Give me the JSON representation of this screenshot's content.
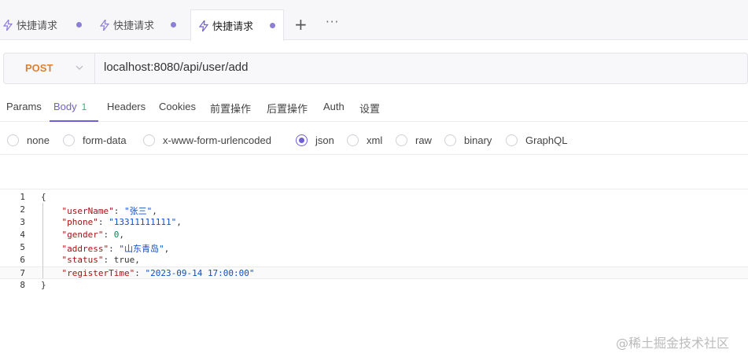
{
  "tabs": [
    {
      "label": "快捷请求"
    },
    {
      "label": "快捷请求"
    },
    {
      "label": "快捷请求"
    }
  ],
  "tab_add": "+",
  "tab_more": "···",
  "request": {
    "method": "POST",
    "url": "localhost:8080/api/user/add"
  },
  "subtabs": [
    {
      "label": "Params"
    },
    {
      "label": "Body",
      "count": "1"
    },
    {
      "label": "Headers"
    },
    {
      "label": "Cookies"
    },
    {
      "label": "前置操作"
    },
    {
      "label": "后置操作"
    },
    {
      "label": "Auth"
    },
    {
      "label": "设置"
    }
  ],
  "body_types": [
    {
      "label": "none"
    },
    {
      "label": "form-data"
    },
    {
      "label": "x-www-form-urlencoded"
    },
    {
      "label": "json",
      "selected": true
    },
    {
      "label": "xml"
    },
    {
      "label": "raw"
    },
    {
      "label": "binary"
    },
    {
      "label": "GraphQL"
    }
  ],
  "editor": {
    "line_numbers": [
      "1",
      "2",
      "3",
      "4",
      "5",
      "6",
      "7",
      "8"
    ],
    "lines": [
      {
        "parts": [
          {
            "t": "p",
            "v": "{"
          }
        ]
      },
      {
        "parts": [
          {
            "t": "p",
            "v": "    "
          },
          {
            "t": "k",
            "v": "\"userName\""
          },
          {
            "t": "p",
            "v": ": "
          },
          {
            "t": "s",
            "v": "\"张三\""
          },
          {
            "t": "p",
            "v": ","
          }
        ]
      },
      {
        "parts": [
          {
            "t": "p",
            "v": "    "
          },
          {
            "t": "k",
            "v": "\"phone\""
          },
          {
            "t": "p",
            "v": ": "
          },
          {
            "t": "s",
            "v": "\"13311111111\""
          },
          {
            "t": "p",
            "v": ","
          }
        ]
      },
      {
        "parts": [
          {
            "t": "p",
            "v": "    "
          },
          {
            "t": "k",
            "v": "\"gender\""
          },
          {
            "t": "p",
            "v": ": "
          },
          {
            "t": "n",
            "v": "0"
          },
          {
            "t": "p",
            "v": ","
          }
        ]
      },
      {
        "parts": [
          {
            "t": "p",
            "v": "    "
          },
          {
            "t": "k",
            "v": "\"address\""
          },
          {
            "t": "p",
            "v": ": "
          },
          {
            "t": "s",
            "v": "\"山东青岛\""
          },
          {
            "t": "p",
            "v": ","
          }
        ]
      },
      {
        "parts": [
          {
            "t": "p",
            "v": "    "
          },
          {
            "t": "k",
            "v": "\"status\""
          },
          {
            "t": "p",
            "v": ": "
          },
          {
            "t": "p",
            "v": "true"
          },
          {
            "t": "p",
            "v": ","
          }
        ]
      },
      {
        "parts": [
          {
            "t": "p",
            "v": "    "
          },
          {
            "t": "k",
            "v": "\"registerTime\""
          },
          {
            "t": "p",
            "v": ": "
          },
          {
            "t": "s",
            "v": "\"2023-09-14 17:00:00\""
          }
        ]
      },
      {
        "parts": [
          {
            "t": "p",
            "v": "}"
          }
        ]
      }
    ],
    "current_line": 7
  },
  "watermark": "@稀土掘金技术社区",
  "colors": {
    "accent": "#6f5fd6",
    "method_post": "#e07f2c",
    "count_badge": "#2fb57a"
  }
}
